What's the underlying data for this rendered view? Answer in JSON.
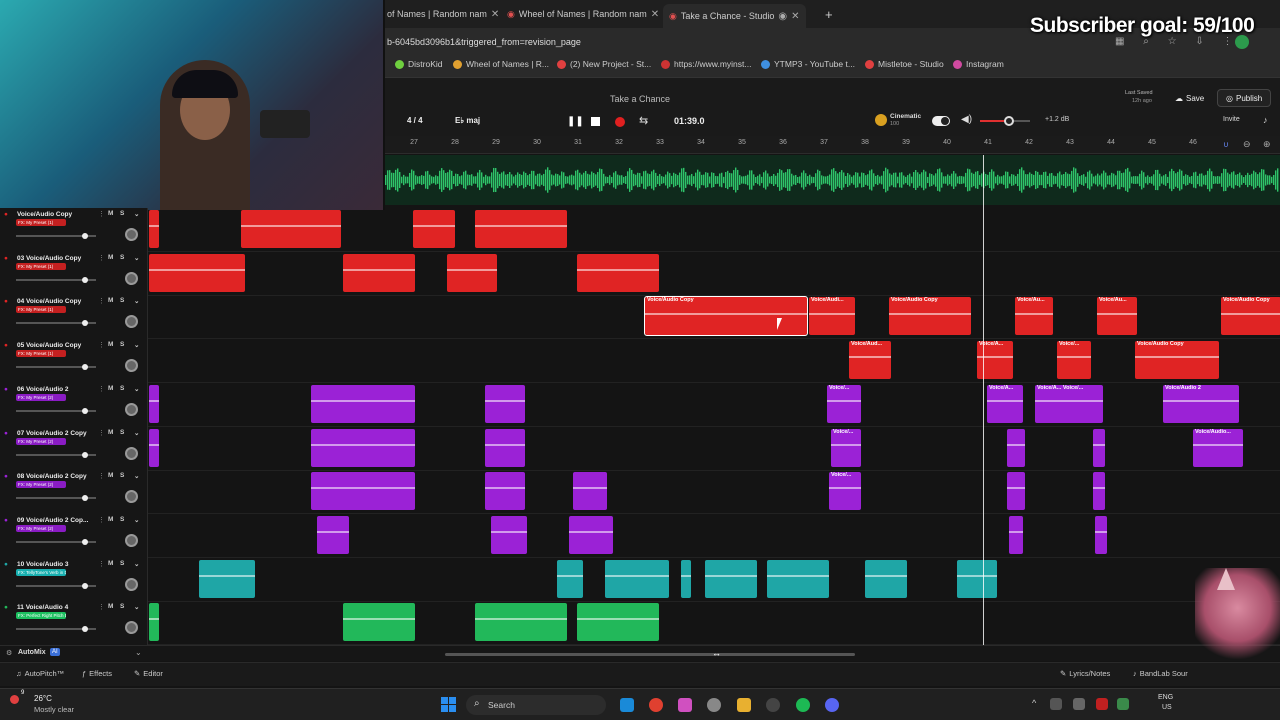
{
  "overlay": {
    "subscriber_goal": "Subscriber goal: 59/100"
  },
  "browser": {
    "tabs": [
      {
        "label": "of Names | Random nam",
        "active": false
      },
      {
        "label": "Wheel of Names | Random nam",
        "active": false
      },
      {
        "label": "Take a Chance - Studio",
        "active": true
      }
    ],
    "new_tab": "+",
    "url": "b-6045bd3096b1&triggered_from=revision_page",
    "bookmarks": [
      {
        "label": "DistroKid",
        "color": "#6fcf3f"
      },
      {
        "label": "Wheel of Names | R...",
        "color": "#e0a030"
      },
      {
        "label": "(2) New Project - St...",
        "color": "#e04040"
      },
      {
        "label": "https://www.myinst...",
        "color": "#cc3333"
      },
      {
        "label": "YTMP3 - YouTube t...",
        "color": "#3f8fe0"
      },
      {
        "label": "Mistletoe - Studio",
        "color": "#e04040"
      },
      {
        "label": "Instagram",
        "color": "#d04aa0"
      }
    ]
  },
  "studio": {
    "project_title": "Take a Chance",
    "time_signature": "4 / 4",
    "key": "E♭ maj",
    "time": "01:39.0",
    "cinematic_label": "Cinematic",
    "cinematic_value": "100",
    "db": "+1.2 dB",
    "last_saved_1": "Last Saved",
    "last_saved_2": "12h ago",
    "save": "Save",
    "publish": "Publish",
    "invite": "Invite"
  },
  "ruler": [
    "27",
    "28",
    "29",
    "30",
    "31",
    "32",
    "33",
    "34",
    "35",
    "36",
    "37",
    "38",
    "39",
    "40",
    "41",
    "42",
    "43",
    "44",
    "45",
    "46"
  ],
  "tracks": [
    {
      "num": "",
      "name": "Voice/Audio Copy",
      "fx": "FX: My Preset (1)",
      "color": "#e02424",
      "fxcolor": "#c42020",
      "clips": [
        [
          0,
          10,
          ""
        ],
        [
          92,
          100,
          ""
        ],
        [
          264,
          42,
          ""
        ],
        [
          326,
          92,
          ""
        ]
      ]
    },
    {
      "num": "03",
      "name": "Voice/Audio Copy",
      "fx": "FX: My Preset (1)",
      "color": "#e02424",
      "fxcolor": "#c42020",
      "clips": [
        [
          0,
          96,
          ""
        ],
        [
          194,
          72,
          ""
        ],
        [
          298,
          50,
          ""
        ],
        [
          428,
          82,
          ""
        ]
      ]
    },
    {
      "num": "04",
      "name": "Voice/Audio Copy",
      "fx": "FX: My Preset (1)",
      "color": "#e02424",
      "fxcolor": "#c42020",
      "clips": [
        [
          496,
          162,
          "Voice/Audio Copy"
        ],
        [
          660,
          46,
          "Voice/Audi..."
        ],
        [
          740,
          82,
          "Voice/Audio Copy"
        ],
        [
          866,
          38,
          "Voice/Au..."
        ],
        [
          948,
          40,
          "Voice/Au..."
        ],
        [
          1072,
          60,
          "Voice/Audio Copy"
        ]
      ]
    },
    {
      "num": "05",
      "name": "Voice/Audio Copy",
      "fx": "FX: My Preset (1)",
      "color": "#e02424",
      "fxcolor": "#c42020",
      "clips": [
        [
          700,
          42,
          "Voice/Aud..."
        ],
        [
          828,
          36,
          "Voice/A..."
        ],
        [
          908,
          34,
          "Voice/..."
        ],
        [
          986,
          84,
          "Voice/Audio Copy"
        ]
      ]
    },
    {
      "num": "06",
      "name": "Voice/Audio 2",
      "fx": "FX: My Preset (2)",
      "color": "#9b22d6",
      "fxcolor": "#8a1cc4",
      "clips": [
        [
          0,
          10,
          ""
        ],
        [
          162,
          104,
          ""
        ],
        [
          336,
          40,
          ""
        ],
        [
          678,
          34,
          "Voice/..."
        ],
        [
          838,
          36,
          "Voice/A..."
        ],
        [
          886,
          68,
          "Voice/A... Voice/..."
        ],
        [
          1014,
          76,
          "Voice/Audio 2"
        ]
      ]
    },
    {
      "num": "07",
      "name": "Voice/Audio 2 Copy",
      "fx": "FX: My Preset (2)",
      "color": "#9b22d6",
      "fxcolor": "#8a1cc4",
      "clips": [
        [
          0,
          10,
          ""
        ],
        [
          162,
          104,
          ""
        ],
        [
          336,
          40,
          ""
        ],
        [
          682,
          30,
          "Voice/..."
        ],
        [
          858,
          18,
          ""
        ],
        [
          944,
          12,
          ""
        ],
        [
          1044,
          50,
          "Voice/Audio..."
        ]
      ]
    },
    {
      "num": "08",
      "name": "Voice/Audio 2 Copy",
      "fx": "FX: My Preset (2)",
      "color": "#9b22d6",
      "fxcolor": "#8a1cc4",
      "clips": [
        [
          162,
          104,
          ""
        ],
        [
          336,
          40,
          ""
        ],
        [
          424,
          34,
          ""
        ],
        [
          680,
          32,
          "Voice/..."
        ],
        [
          858,
          18,
          ""
        ],
        [
          944,
          12,
          ""
        ]
      ]
    },
    {
      "num": "09",
      "name": "Voice/Audio 2 Cop...",
      "fx": "FX: My Preset (2)",
      "color": "#9b22d6",
      "fxcolor": "#8a1cc4",
      "clips": [
        [
          168,
          32,
          ""
        ],
        [
          342,
          36,
          ""
        ],
        [
          420,
          44,
          ""
        ],
        [
          860,
          14,
          ""
        ],
        [
          946,
          12,
          ""
        ]
      ]
    },
    {
      "num": "10",
      "name": "Voice/Audio 3",
      "fx": "FX: TellyTone's Verb in DeltY",
      "color": "#1fa6a6",
      "fxcolor": "#18b0b0",
      "clips": [
        [
          50,
          56,
          ""
        ],
        [
          408,
          26,
          ""
        ],
        [
          456,
          64,
          ""
        ],
        [
          532,
          10,
          ""
        ],
        [
          556,
          52,
          ""
        ],
        [
          618,
          62,
          ""
        ],
        [
          716,
          42,
          ""
        ],
        [
          808,
          40,
          ""
        ]
      ]
    },
    {
      "num": "11",
      "name": "Voice/Audio 4",
      "fx": "FX: Perfect Right Pitch Bks",
      "color": "#22b85a",
      "fxcolor": "#1cc060",
      "clips": [
        [
          0,
          10,
          ""
        ],
        [
          194,
          72,
          ""
        ],
        [
          326,
          92,
          ""
        ],
        [
          428,
          82,
          ""
        ]
      ]
    }
  ],
  "automix": {
    "label": "AutoMix",
    "badge": "AI"
  },
  "bottom": {
    "autopitch": "AutoPitch™",
    "effects": "Effects",
    "editor": "Editor",
    "lyrics": "Lyrics/Notes",
    "bandlab": "BandLab Sour"
  },
  "taskbar": {
    "temp": "26°C",
    "weather": "Mostly clear",
    "search": "Search",
    "lang1": "ENG",
    "lang2": "US",
    "notif": "9"
  }
}
